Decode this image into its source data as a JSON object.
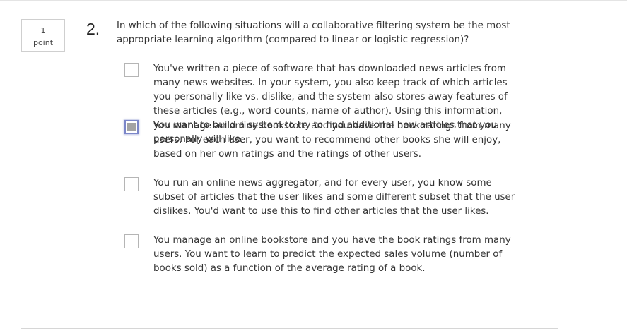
{
  "question": {
    "points_value": "1",
    "points_unit": "point",
    "number": "2.",
    "text": "In which of the following situations will a collaborative filtering system be the most appropriate learning algorithm (compared to linear or logistic regression)?",
    "options": [
      {
        "label": "You've written a piece of software that has downloaded news articles from many news websites. In your system, you also keep track of which articles you personally like vs. dislike, and the system also stores away features of these articles (e.g., word counts, name of author). Using this information, you want to build a system to try to find additional new articles that you personally will like.",
        "checked": false
      },
      {
        "label": "You manage an online bookstore and you have the book ratings from many users. For each user, you want to recommend other books she will enjoy, based on her own ratings and the ratings of other users.",
        "checked": true
      },
      {
        "label": "You run an online news aggregator, and for every user, you know some subset of articles that the user likes and some different subset that the user dislikes. You'd want to use this to find other articles that the user likes.",
        "checked": false
      },
      {
        "label": "You manage an online bookstore and you have the book ratings from many users. You want to learn to predict the expected sales volume (number of books sold) as a function of the average rating of a book.",
        "checked": false
      }
    ]
  },
  "colors": {
    "checked_border": "#7b86c9",
    "checked_fill": "#a3a3a3",
    "text": "#333333",
    "rule": "#e4e4e4"
  }
}
